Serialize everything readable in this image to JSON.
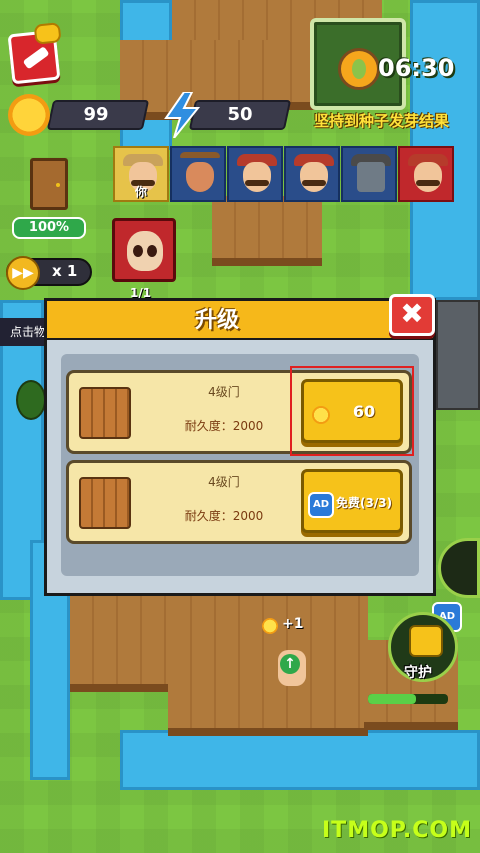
{
  "hud": {
    "sun_count": "99",
    "energy_count": "50",
    "timer": "06:30",
    "objective": "坚持到种子发芽结果",
    "door_health": "100%",
    "speed_label": "x 1",
    "skull_count": "1/1",
    "left_tip": "点击物"
  },
  "players": [
    {
      "label": "你",
      "kind": "self"
    },
    {
      "label": "",
      "kind": "deer"
    },
    {
      "label": "",
      "kind": "farmer"
    },
    {
      "label": "",
      "kind": "farmer"
    },
    {
      "label": "",
      "kind": "robot"
    },
    {
      "label": "",
      "kind": "red"
    }
  ],
  "dialog": {
    "title": "升级",
    "close_label": "✖",
    "rows": [
      {
        "level": "4级门",
        "durability": "耐久度：2000",
        "button": "60",
        "button_type": "coin"
      },
      {
        "level": "4级门",
        "durability": "耐久度：2000",
        "button": "免费(3/3)",
        "button_type": "ad"
      }
    ]
  },
  "world": {
    "sun_gain": "+1",
    "guard_label": "守护",
    "ad_label": "AD"
  },
  "watermark": "ITMOP.COM",
  "colors": {
    "dialog_header": "#f6b81a",
    "button_gold": "#f6c21a",
    "close_red": "#e23b36",
    "highlight_red": "#e02020"
  }
}
